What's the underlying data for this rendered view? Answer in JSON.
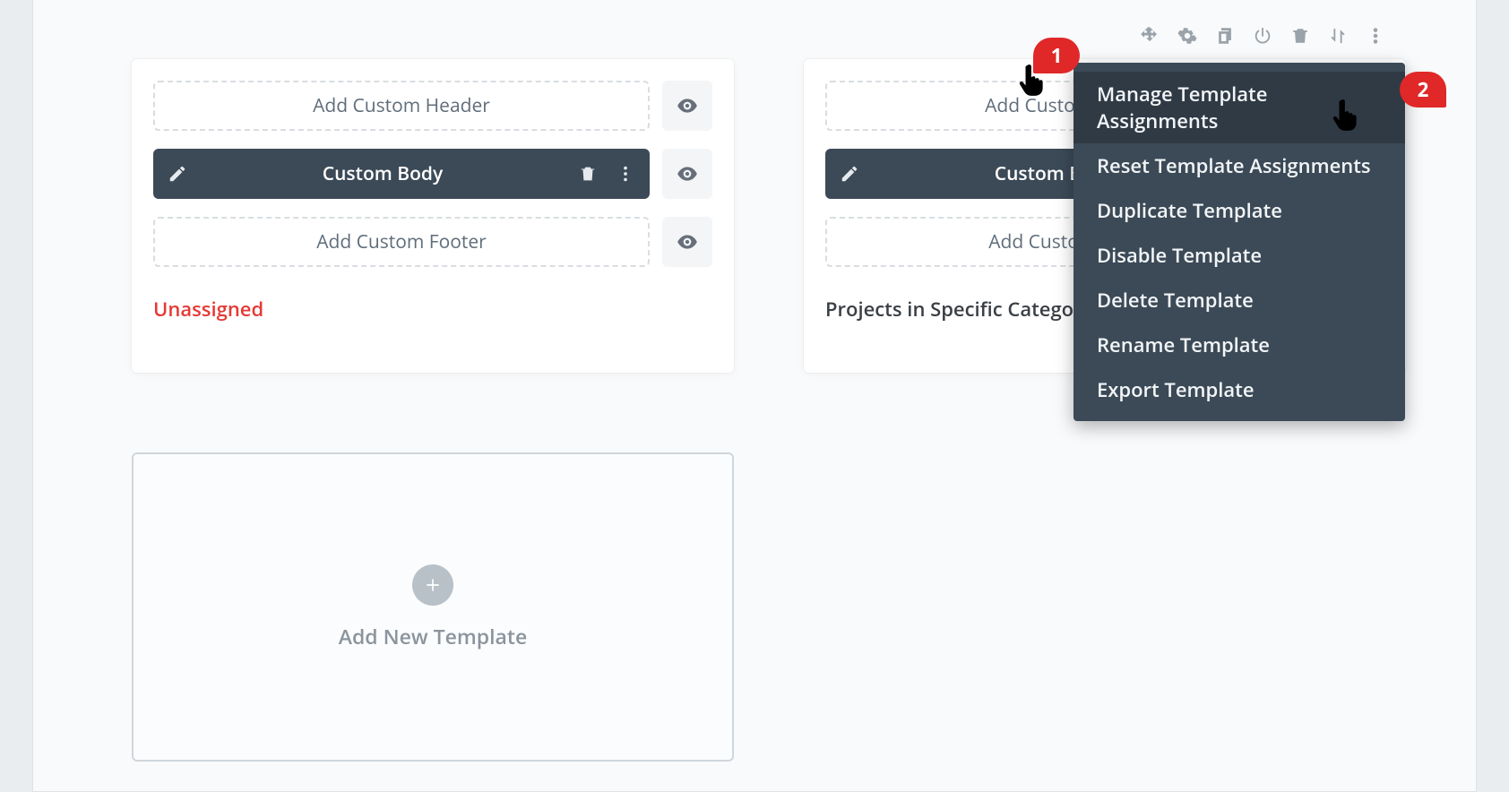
{
  "left_card": {
    "header_slot": "Add Custom Header",
    "body_label": "Custom Body",
    "footer_slot": "Add Custom Footer",
    "assignment": "Unassigned"
  },
  "right_card": {
    "header_slot": "Add Custom Header",
    "body_label": "Custom Body",
    "footer_slot": "Add Custom Footer",
    "assignment": "Projects in Specific Categories"
  },
  "dropdown": {
    "items": [
      "Manage Template Assignments",
      "Reset Template Assignments",
      "Duplicate Template",
      "Disable Template",
      "Delete Template",
      "Rename Template",
      "Export Template"
    ]
  },
  "add_new": "Add New Template",
  "callouts": {
    "one": "1",
    "two": "2"
  }
}
